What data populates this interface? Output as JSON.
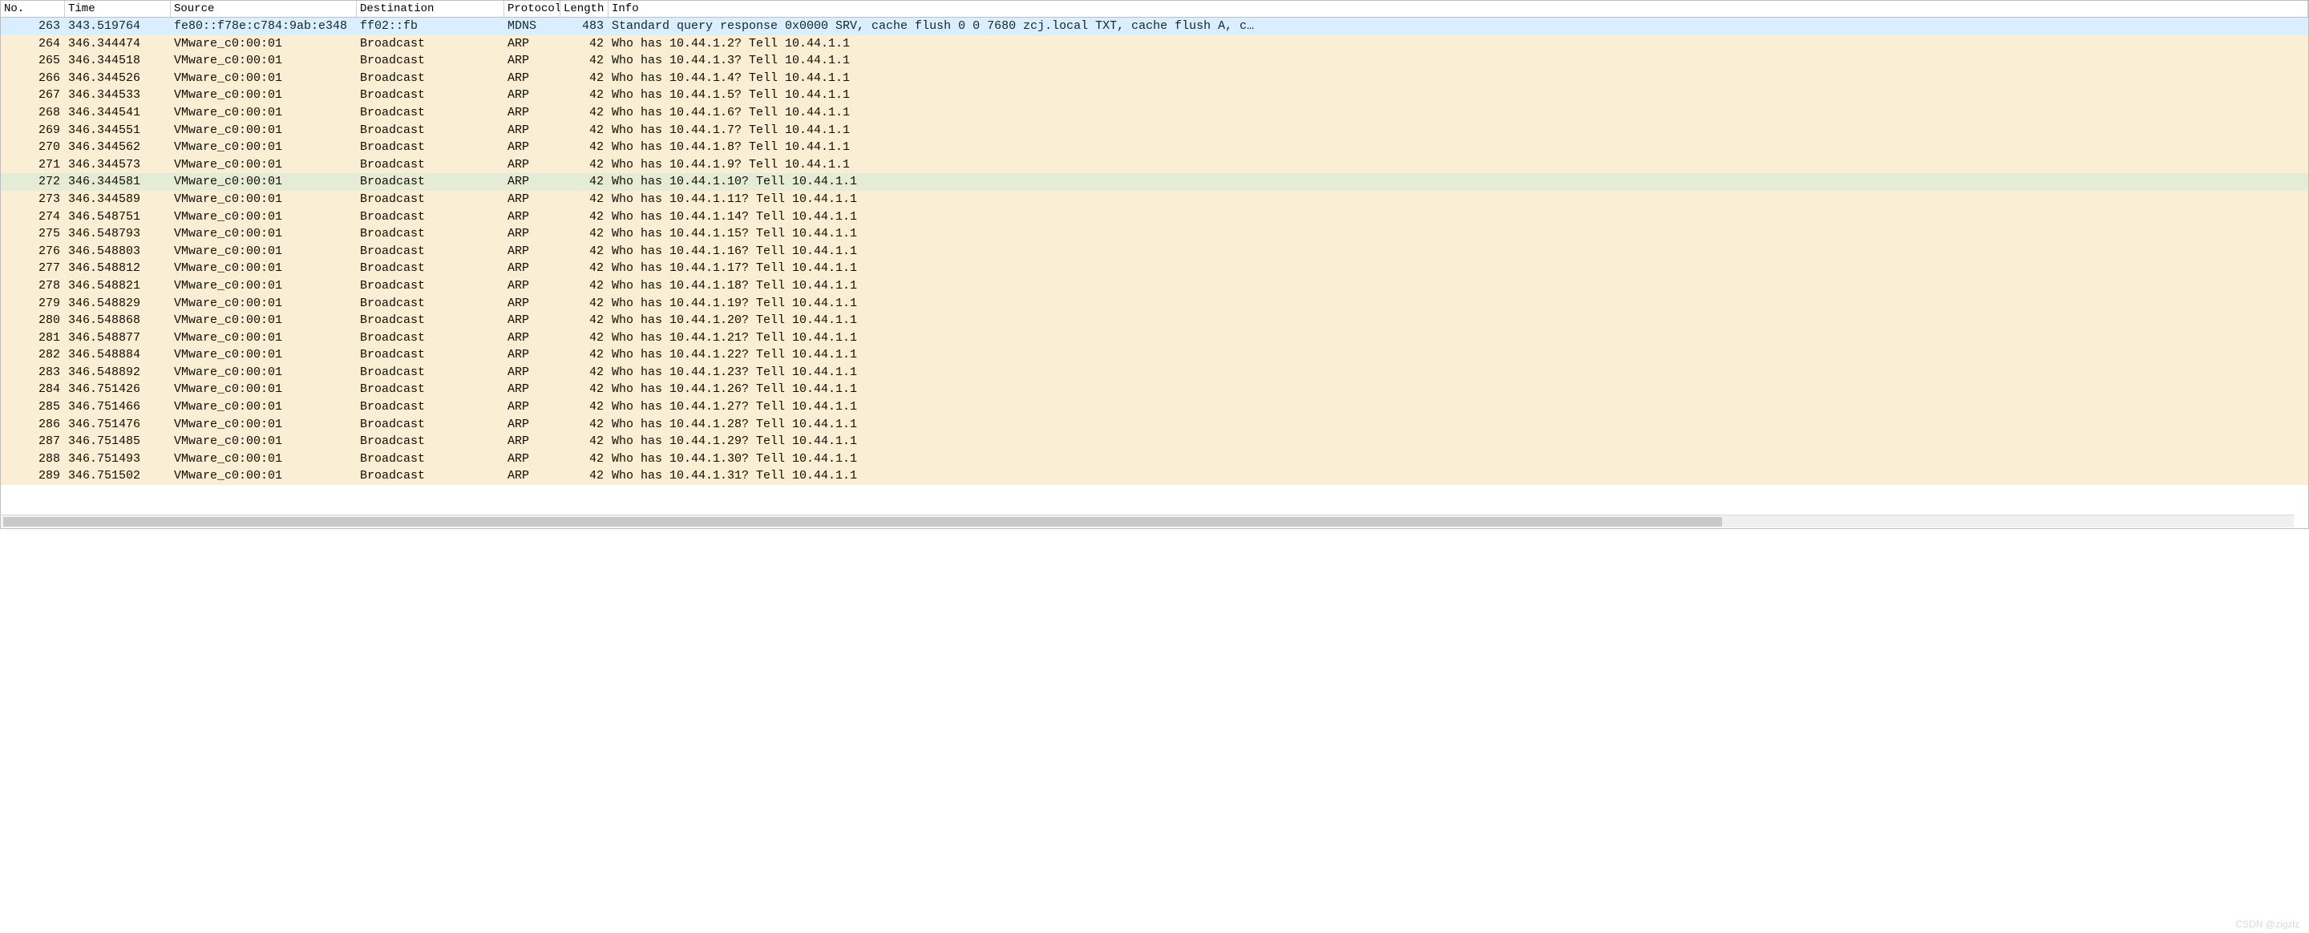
{
  "columns": {
    "no": "No.",
    "time": "Time",
    "source": "Source",
    "destination": "Destination",
    "protocol": "Protocol",
    "length": "Length",
    "info": "Info"
  },
  "selected_index": 0,
  "hover_index": 9,
  "packets": [
    {
      "no": "263",
      "time": "343.519764",
      "source": "fe80::f78e:c784:9ab:e348",
      "dest": "ff02::fb",
      "proto": "MDNS",
      "length": "483",
      "info": "Standard query response 0x0000 SRV, cache flush 0 0 7680 zcj.local TXT, cache flush A, c…",
      "cls": "mdns"
    },
    {
      "no": "264",
      "time": "346.344474",
      "source": "VMware_c0:00:01",
      "dest": "Broadcast",
      "proto": "ARP",
      "length": "42",
      "info": "Who has 10.44.1.2? Tell 10.44.1.1",
      "cls": "arp"
    },
    {
      "no": "265",
      "time": "346.344518",
      "source": "VMware_c0:00:01",
      "dest": "Broadcast",
      "proto": "ARP",
      "length": "42",
      "info": "Who has 10.44.1.3? Tell 10.44.1.1",
      "cls": "arp"
    },
    {
      "no": "266",
      "time": "346.344526",
      "source": "VMware_c0:00:01",
      "dest": "Broadcast",
      "proto": "ARP",
      "length": "42",
      "info": "Who has 10.44.1.4? Tell 10.44.1.1",
      "cls": "arp"
    },
    {
      "no": "267",
      "time": "346.344533",
      "source": "VMware_c0:00:01",
      "dest": "Broadcast",
      "proto": "ARP",
      "length": "42",
      "info": "Who has 10.44.1.5? Tell 10.44.1.1",
      "cls": "arp"
    },
    {
      "no": "268",
      "time": "346.344541",
      "source": "VMware_c0:00:01",
      "dest": "Broadcast",
      "proto": "ARP",
      "length": "42",
      "info": "Who has 10.44.1.6? Tell 10.44.1.1",
      "cls": "arp"
    },
    {
      "no": "269",
      "time": "346.344551",
      "source": "VMware_c0:00:01",
      "dest": "Broadcast",
      "proto": "ARP",
      "length": "42",
      "info": "Who has 10.44.1.7? Tell 10.44.1.1",
      "cls": "arp"
    },
    {
      "no": "270",
      "time": "346.344562",
      "source": "VMware_c0:00:01",
      "dest": "Broadcast",
      "proto": "ARP",
      "length": "42",
      "info": "Who has 10.44.1.8? Tell 10.44.1.1",
      "cls": "arp"
    },
    {
      "no": "271",
      "time": "346.344573",
      "source": "VMware_c0:00:01",
      "dest": "Broadcast",
      "proto": "ARP",
      "length": "42",
      "info": "Who has 10.44.1.9? Tell 10.44.1.1",
      "cls": "arp"
    },
    {
      "no": "272",
      "time": "346.344581",
      "source": "VMware_c0:00:01",
      "dest": "Broadcast",
      "proto": "ARP",
      "length": "42",
      "info": "Who has 10.44.1.10? Tell 10.44.1.1",
      "cls": "arp"
    },
    {
      "no": "273",
      "time": "346.344589",
      "source": "VMware_c0:00:01",
      "dest": "Broadcast",
      "proto": "ARP",
      "length": "42",
      "info": "Who has 10.44.1.11? Tell 10.44.1.1",
      "cls": "arp"
    },
    {
      "no": "274",
      "time": "346.548751",
      "source": "VMware_c0:00:01",
      "dest": "Broadcast",
      "proto": "ARP",
      "length": "42",
      "info": "Who has 10.44.1.14? Tell 10.44.1.1",
      "cls": "arp"
    },
    {
      "no": "275",
      "time": "346.548793",
      "source": "VMware_c0:00:01",
      "dest": "Broadcast",
      "proto": "ARP",
      "length": "42",
      "info": "Who has 10.44.1.15? Tell 10.44.1.1",
      "cls": "arp"
    },
    {
      "no": "276",
      "time": "346.548803",
      "source": "VMware_c0:00:01",
      "dest": "Broadcast",
      "proto": "ARP",
      "length": "42",
      "info": "Who has 10.44.1.16? Tell 10.44.1.1",
      "cls": "arp"
    },
    {
      "no": "277",
      "time": "346.548812",
      "source": "VMware_c0:00:01",
      "dest": "Broadcast",
      "proto": "ARP",
      "length": "42",
      "info": "Who has 10.44.1.17? Tell 10.44.1.1",
      "cls": "arp"
    },
    {
      "no": "278",
      "time": "346.548821",
      "source": "VMware_c0:00:01",
      "dest": "Broadcast",
      "proto": "ARP",
      "length": "42",
      "info": "Who has 10.44.1.18? Tell 10.44.1.1",
      "cls": "arp"
    },
    {
      "no": "279",
      "time": "346.548829",
      "source": "VMware_c0:00:01",
      "dest": "Broadcast",
      "proto": "ARP",
      "length": "42",
      "info": "Who has 10.44.1.19? Tell 10.44.1.1",
      "cls": "arp"
    },
    {
      "no": "280",
      "time": "346.548868",
      "source": "VMware_c0:00:01",
      "dest": "Broadcast",
      "proto": "ARP",
      "length": "42",
      "info": "Who has 10.44.1.20? Tell 10.44.1.1",
      "cls": "arp"
    },
    {
      "no": "281",
      "time": "346.548877",
      "source": "VMware_c0:00:01",
      "dest": "Broadcast",
      "proto": "ARP",
      "length": "42",
      "info": "Who has 10.44.1.21? Tell 10.44.1.1",
      "cls": "arp"
    },
    {
      "no": "282",
      "time": "346.548884",
      "source": "VMware_c0:00:01",
      "dest": "Broadcast",
      "proto": "ARP",
      "length": "42",
      "info": "Who has 10.44.1.22? Tell 10.44.1.1",
      "cls": "arp"
    },
    {
      "no": "283",
      "time": "346.548892",
      "source": "VMware_c0:00:01",
      "dest": "Broadcast",
      "proto": "ARP",
      "length": "42",
      "info": "Who has 10.44.1.23? Tell 10.44.1.1",
      "cls": "arp"
    },
    {
      "no": "284",
      "time": "346.751426",
      "source": "VMware_c0:00:01",
      "dest": "Broadcast",
      "proto": "ARP",
      "length": "42",
      "info": "Who has 10.44.1.26? Tell 10.44.1.1",
      "cls": "arp"
    },
    {
      "no": "285",
      "time": "346.751466",
      "source": "VMware_c0:00:01",
      "dest": "Broadcast",
      "proto": "ARP",
      "length": "42",
      "info": "Who has 10.44.1.27? Tell 10.44.1.1",
      "cls": "arp"
    },
    {
      "no": "286",
      "time": "346.751476",
      "source": "VMware_c0:00:01",
      "dest": "Broadcast",
      "proto": "ARP",
      "length": "42",
      "info": "Who has 10.44.1.28? Tell 10.44.1.1",
      "cls": "arp"
    },
    {
      "no": "287",
      "time": "346.751485",
      "source": "VMware_c0:00:01",
      "dest": "Broadcast",
      "proto": "ARP",
      "length": "42",
      "info": "Who has 10.44.1.29? Tell 10.44.1.1",
      "cls": "arp"
    },
    {
      "no": "288",
      "time": "346.751493",
      "source": "VMware_c0:00:01",
      "dest": "Broadcast",
      "proto": "ARP",
      "length": "42",
      "info": "Who has 10.44.1.30? Tell 10.44.1.1",
      "cls": "arp"
    },
    {
      "no": "289",
      "time": "346.751502",
      "source": "VMware_c0:00:01",
      "dest": "Broadcast",
      "proto": "ARP",
      "length": "42",
      "info": "Who has 10.44.1.31? Tell 10.44.1.1",
      "cls": "arp"
    }
  ],
  "watermark": "CSDN @zigzlz"
}
